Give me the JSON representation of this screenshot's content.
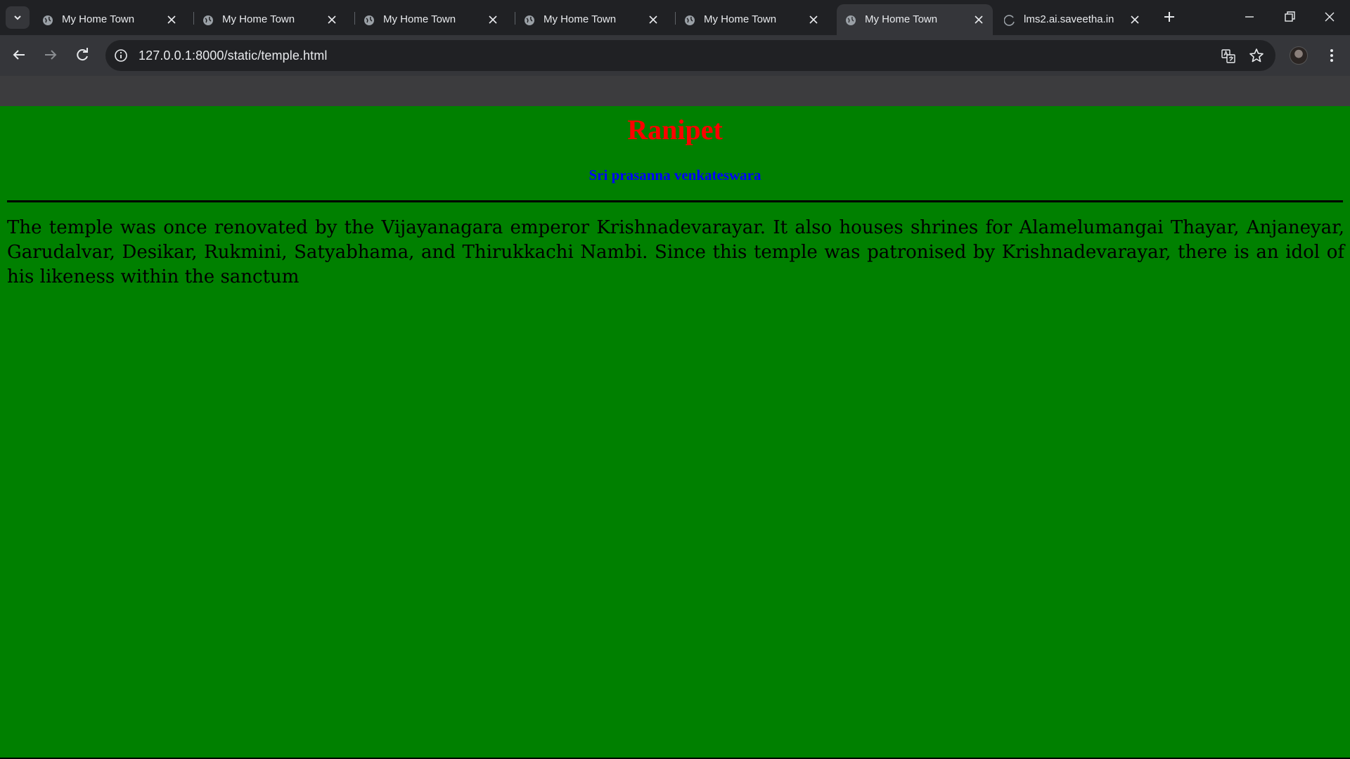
{
  "browser": {
    "tabs": [
      {
        "title": "My Home Town",
        "favicon": "globe-icon",
        "active": false
      },
      {
        "title": "My Home Town",
        "favicon": "globe-icon",
        "active": false
      },
      {
        "title": "My Home Town",
        "favicon": "globe-icon",
        "active": false
      },
      {
        "title": "My Home Town",
        "favicon": "globe-icon",
        "active": false
      },
      {
        "title": "My Home Town",
        "favicon": "globe-icon",
        "active": false
      },
      {
        "title": "My Home Town",
        "favicon": "globe-icon",
        "active": true
      },
      {
        "title": "lms2.ai.saveetha.in",
        "favicon": "loading-spinner-icon",
        "active": false
      }
    ],
    "address_bar": {
      "url": "127.0.0.1:8000/static/temple.html"
    }
  },
  "page": {
    "background_color": "#008000",
    "title": "Ranipet",
    "title_color": "#ff0000",
    "subtitle": "Sri prasanna venkateswara",
    "subtitle_color": "#0000ff",
    "paragraph": "The temple was once renovated by the Vijayanagara emperor Krishnadevarayar. It also houses shrines for Alamelumangai Thayar, Anjaneyar, Garudalvar, Desikar, Rukmini, Satyabhama, and Thirukkachi Nambi. Since this temple was patronised by Krishnadevarayar, there is an idol of his likeness within the sanctum"
  }
}
